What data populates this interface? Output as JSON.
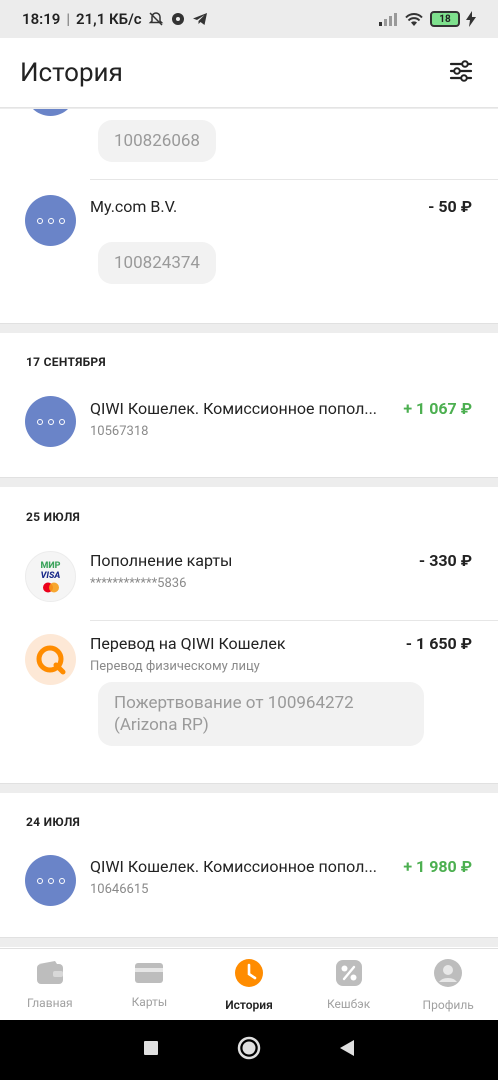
{
  "status_bar": {
    "time": "18:19",
    "speed": "21,1 КБ/с",
    "battery": "18"
  },
  "header": {
    "title": "История"
  },
  "groups": [
    {
      "date": "",
      "items": [
        {
          "title": "",
          "amount": "",
          "bubble": "100826068",
          "avatar": "dots-icon"
        },
        {
          "title": "My.com B.V.",
          "amount": "- 50 ₽",
          "bubble": "100824374",
          "avatar": "dots-icon"
        }
      ]
    },
    {
      "date": "17 СЕНТЯБРЯ",
      "items": [
        {
          "title": "QIWI Кошелек. Комиссионное попол...",
          "amount": "+ 1 067 ₽",
          "sub": "10567318",
          "avatar": "dots-icon"
        }
      ]
    },
    {
      "date": "25 ИЮЛЯ",
      "items": [
        {
          "title": "Пополнение карты",
          "amount": "- 330 ₽",
          "sub": "************5836",
          "avatar": "card-brands-icon"
        },
        {
          "title": "Перевод на QIWI Кошелек",
          "amount": "- 1 650 ₽",
          "sub": "Перевод физическому лицу",
          "bubble": "Пожертвование от 100964272 (Arizona RP)",
          "avatar": "qiwi-logo-icon"
        }
      ]
    },
    {
      "date": "24 ИЮЛЯ",
      "items": [
        {
          "title": "QIWI Кошелек. Комиссионное попол...",
          "amount": "+ 1 980 ₽",
          "sub": "10646615",
          "avatar": "dots-icon"
        }
      ]
    }
  ],
  "card_logo": {
    "mir": "МИР",
    "visa": "VISA"
  },
  "bottom_nav": [
    {
      "label": "Главная",
      "icon": "wallet-icon"
    },
    {
      "label": "Карты",
      "icon": "card-icon"
    },
    {
      "label": "История",
      "icon": "clock-icon",
      "active": true
    },
    {
      "label": "Кешбэк",
      "icon": "percent-icon"
    },
    {
      "label": "Профиль",
      "icon": "profile-icon"
    }
  ],
  "colors": {
    "accent_orange": "#ff8c00",
    "positive_green": "#4caf50",
    "avatar_blue": "#6a84c8"
  }
}
